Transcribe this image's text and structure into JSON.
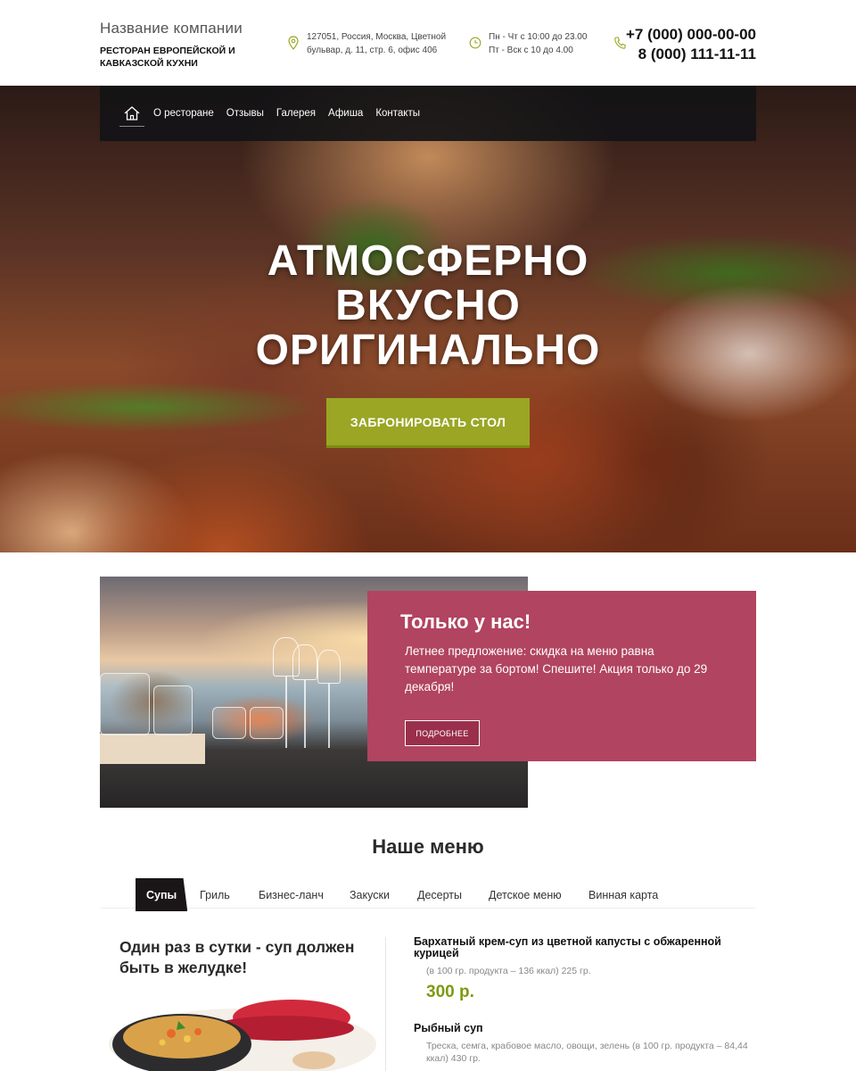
{
  "header": {
    "company_name": "Название компании",
    "company_sub_line1": "РЕСТОРАН ЕВРОПЕЙСКОЙ И",
    "company_sub_line2": "КАВКАЗСКОЙ КУХНИ",
    "address_line1": "127051, Россия, Москва, Цветной",
    "address_line2": "бульвар, д. 11, стр. 6, офис 406",
    "hours_line1": "Пн - Чт с 10:00 до 23.00",
    "hours_line2": "Пт - Вск с 10 до 4.00",
    "phone1": "+7 (000) 000-00-00",
    "phone2": "8 (000) 111-11-11",
    "address_icon": "map-pin-icon",
    "hours_icon": "clock-icon",
    "phone_icon": "phone-icon"
  },
  "nav": {
    "home_icon": "home-icon",
    "items": [
      "О ресторане",
      "Отзывы",
      "Галерея",
      "Афиша",
      "Контакты"
    ]
  },
  "hero": {
    "title_line1": "АТМОСФЕРНО",
    "title_line2": "ВКУСНО",
    "title_line3": "ОРИГИНАЛЬНО",
    "cta_label": "ЗАБРОНИРОВАТЬ СТОЛ",
    "cta_color": "#9aa624"
  },
  "promo": {
    "title": "Только у нас!",
    "text": "Летнее предложение: скидка на меню равна температуре за бортом! Спешите! Акция только до 29 декабря!",
    "button_label": "ПОДРОБНЕЕ",
    "box_color": "#b14460"
  },
  "menu": {
    "title": "Наше меню",
    "tabs": [
      "Супы",
      "Гриль",
      "Бизнес-ланч",
      "Закуски",
      "Десерты",
      "Детское меню",
      "Винная карта"
    ],
    "active_tab": "Супы",
    "left_heading": "Один раз в сутки - суп должен быть в желудке!",
    "dishes": [
      {
        "name": "Бархатный крем-суп из цветной капусты с обжаренной курицей",
        "desc": "(в 100 гр. продукта – 136 ккал)  225 гр.",
        "price": "300 р."
      },
      {
        "name": "Рыбный суп",
        "desc": "Треска, семга, крабовое масло, овощи, зелень (в 100 гр. продукта – 84,44 ккал) 430 гр.",
        "price": ""
      }
    ],
    "price_color": "#7c9a10"
  }
}
